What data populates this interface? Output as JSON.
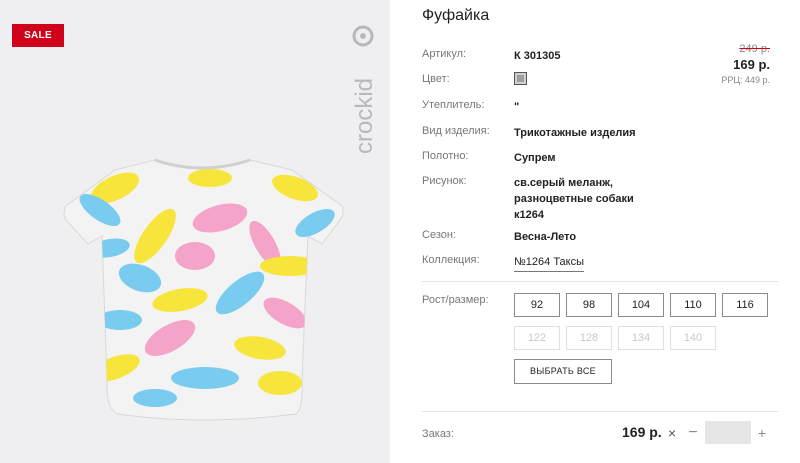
{
  "badge": {
    "sale": "SALE"
  },
  "brand": {
    "logo_text": "crockid"
  },
  "product": {
    "title": "Фуфайка",
    "attributes": [
      {
        "label": "Артикул:",
        "value": "К 301305"
      },
      {
        "label": "Цвет:",
        "value": ""
      },
      {
        "label": "Утеплитель:",
        "value": "\""
      },
      {
        "label": "Вид изделия:",
        "value": "Трикотажные изделия"
      },
      {
        "label": "Полотно:",
        "value": "Супрем"
      },
      {
        "label": "Рисунок:",
        "value_lines": [
          "св.серый меланж,",
          "разноцветные собаки",
          "к1264"
        ]
      },
      {
        "label": "Сезон:",
        "value": "Весна-Лето"
      },
      {
        "label": "Коллекция:",
        "value": "№1264 Таксы"
      }
    ],
    "color_swatch": "#9e9e9e"
  },
  "price": {
    "old": "249 р.",
    "current": "169 р.",
    "rrp": "РРЦ: 449 р."
  },
  "sizes": {
    "label": "Рост/размер:",
    "available": [
      "92",
      "98",
      "104",
      "110",
      "116"
    ],
    "unavailable": [
      "122",
      "128",
      "134",
      "140"
    ],
    "select_all": "ВЫБРАТЬ ВСЕ"
  },
  "order": {
    "label": "Заказ:",
    "price": "169 р.",
    "times": "×",
    "minus": "−",
    "plus": "+",
    "quantity": ""
  },
  "colors": {
    "sale_red": "#d0021b",
    "image_bg": "#efeef1"
  }
}
